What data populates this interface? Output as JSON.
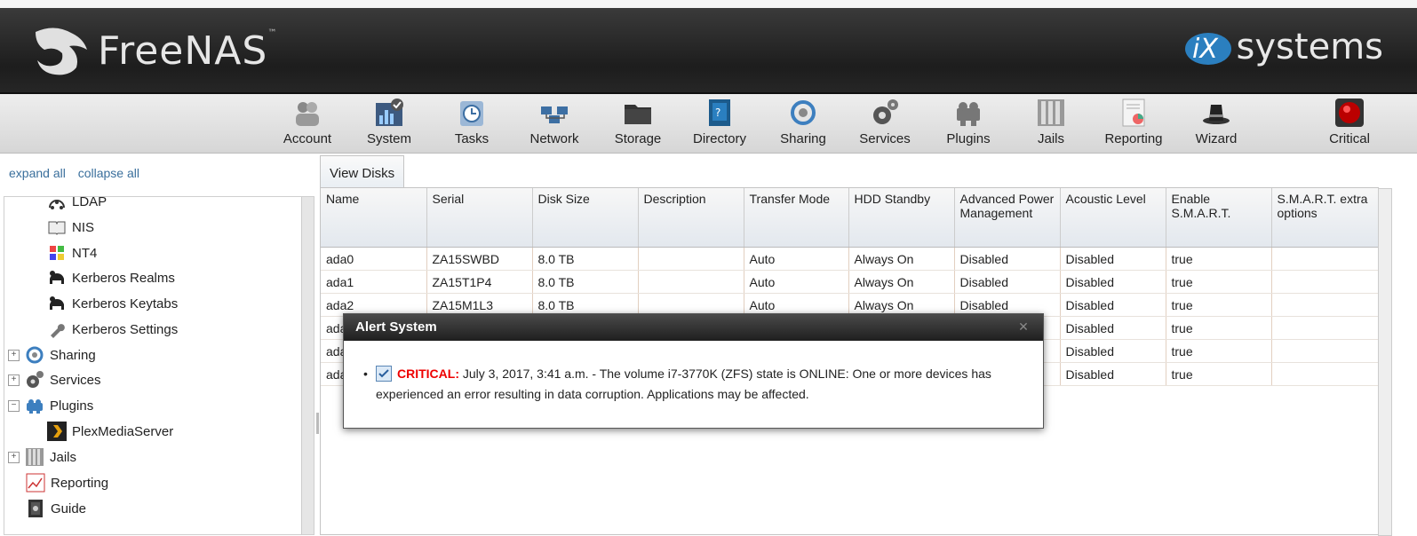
{
  "app": {
    "brand": "FreeNAS",
    "brand_tm": "™",
    "vendor": "systems"
  },
  "toolbar": {
    "items": [
      {
        "label": "Account",
        "icon": "account-icon"
      },
      {
        "label": "System",
        "icon": "system-icon"
      },
      {
        "label": "Tasks",
        "icon": "tasks-icon"
      },
      {
        "label": "Network",
        "icon": "network-icon"
      },
      {
        "label": "Storage",
        "icon": "storage-icon"
      },
      {
        "label": "Directory",
        "icon": "directory-icon"
      },
      {
        "label": "Sharing",
        "icon": "sharing-icon"
      },
      {
        "label": "Services",
        "icon": "services-icon"
      },
      {
        "label": "Plugins",
        "icon": "plugins-icon"
      },
      {
        "label": "Jails",
        "icon": "jails-icon"
      },
      {
        "label": "Reporting",
        "icon": "reporting-icon"
      },
      {
        "label": "Wizard",
        "icon": "wizard-icon"
      }
    ],
    "critical_label": "Critical"
  },
  "sidebar": {
    "expand_all": "expand all",
    "collapse_all": "collapse all",
    "items": [
      {
        "label": "LDAP",
        "icon": "ldap-icon"
      },
      {
        "label": "NIS",
        "icon": "nis-icon"
      },
      {
        "label": "NT4",
        "icon": "nt4-icon"
      },
      {
        "label": "Kerberos Realms",
        "icon": "kerberos-icon"
      },
      {
        "label": "Kerberos Keytabs",
        "icon": "kerberos-icon"
      },
      {
        "label": "Kerberos Settings",
        "icon": "wrench-icon"
      },
      {
        "label": "Sharing",
        "icon": "sharing-icon"
      },
      {
        "label": "Services",
        "icon": "services-icon"
      },
      {
        "label": "Plugins",
        "icon": "plugins-icon"
      },
      {
        "label": "PlexMediaServer",
        "icon": "plex-icon"
      },
      {
        "label": "Jails",
        "icon": "jails-icon"
      },
      {
        "label": "Reporting",
        "icon": "reporting-icon"
      },
      {
        "label": "Guide",
        "icon": "guide-icon"
      }
    ]
  },
  "main": {
    "tab_label": "View Disks",
    "columns": [
      "Name",
      "Serial",
      "Disk Size",
      "Description",
      "Transfer Mode",
      "HDD Standby",
      "Advanced Power Management",
      "Acoustic Level",
      "Enable S.M.A.R.T.",
      "S.M.A.R.T. extra options"
    ],
    "rows": [
      [
        "ada0",
        "ZA15SWBD",
        "8.0 TB",
        "",
        "Auto",
        "Always On",
        "Disabled",
        "Disabled",
        "true",
        ""
      ],
      [
        "ada1",
        "ZA15T1P4",
        "8.0 TB",
        "",
        "Auto",
        "Always On",
        "Disabled",
        "Disabled",
        "true",
        ""
      ],
      [
        "ada2",
        "ZA15M1L3",
        "8.0 TB",
        "",
        "Auto",
        "Always On",
        "Disabled",
        "Disabled",
        "true",
        ""
      ],
      [
        "ada",
        "",
        "",
        "",
        "",
        "",
        "",
        "Disabled",
        "true",
        ""
      ],
      [
        "ada",
        "",
        "",
        "",
        "",
        "",
        "",
        "Disabled",
        "true",
        ""
      ],
      [
        "ada",
        "",
        "",
        "",
        "",
        "",
        "",
        "Disabled",
        "true",
        ""
      ]
    ]
  },
  "alert": {
    "title": "Alert System",
    "level": "CRITICAL:",
    "message": "July 3, 2017, 3:41 a.m. - The volume i7-3770K (ZFS) state is ONLINE: One or more devices has experienced an error resulting in data corruption. Applications may be affected.",
    "close_icon": "close-icon"
  }
}
